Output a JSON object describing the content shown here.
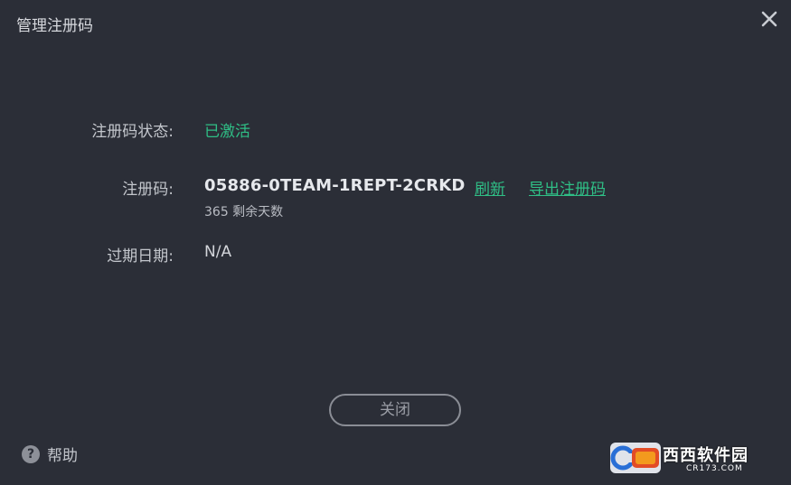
{
  "window": {
    "title": "管理注册码"
  },
  "status": {
    "label": "注册码状态:",
    "value": "已激活"
  },
  "license": {
    "label": "注册码:",
    "code": "05886-0TEAM-1REPT-2CRKD",
    "refresh_link": "刷新",
    "export_link": "导出注册码",
    "days_left": "365 剩余天数"
  },
  "expiry": {
    "label": "过期日期:",
    "value": "N/A"
  },
  "buttons": {
    "close_label": "关闭"
  },
  "help": {
    "icon_glyph": "?",
    "label": "帮助"
  },
  "watermark": {
    "title": "西西软件园",
    "subtitle": "CR173.COM"
  },
  "colors": {
    "background": "#2b2e37",
    "accent_green": "#2fbf86",
    "text": "#c3c6cc"
  },
  "icons": {
    "close": "close-icon",
    "help": "help-icon"
  }
}
